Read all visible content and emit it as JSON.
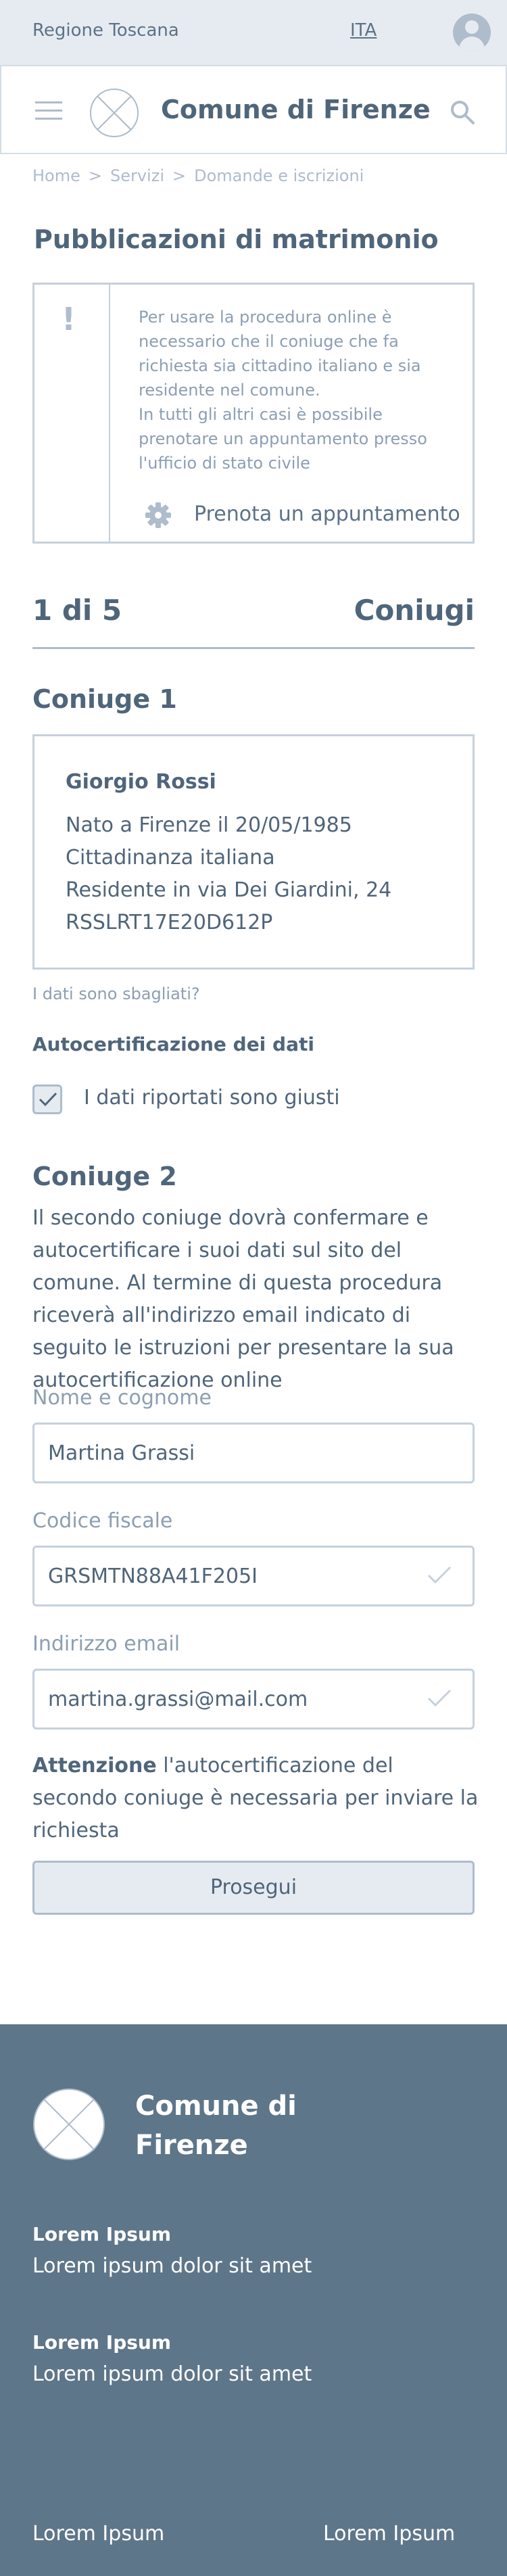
{
  "topbar": {
    "region": "Regione Toscana",
    "language": "ITA",
    "avatar_icon": "user-avatar-icon"
  },
  "header": {
    "title": "Comune di Firenze",
    "menu_icon": "hamburger-icon",
    "search_icon": "search-icon"
  },
  "breadcrumb": {
    "items": [
      "Home",
      "Servizi",
      "Domande e iscrizioni"
    ]
  },
  "page": {
    "title": "Pubblicazioni di matrimonio"
  },
  "alert": {
    "text": "Per usare la procedura online è\nnecessario che il coniuge che fa\nrichiesta sia cittadino italiano e sia\nresidente nel comune.\nIn tutti gli altri casi è possibile\nprenotare un appuntamento presso\nl'ufficio di stato civile",
    "link": "Prenota un appuntamento"
  },
  "steps": {
    "count": "1 di 5",
    "name": "Coniugi"
  },
  "spouse1": {
    "heading": "Coniuge 1",
    "name": "Giorgio Rossi",
    "lines": [
      "Nato a Firenze il 20/05/1985",
      "Cittadinanza italiana",
      "Residente in via Dei Giardini, 24",
      "RSSLRT17E20D612P"
    ],
    "wrong_link": "I dati sono sbagliati?",
    "self_cert_label": "Autocertificazione dei dati",
    "checkbox_label": "I dati riportati sono giusti",
    "checked": true
  },
  "spouse2": {
    "heading": "Coniuge 2",
    "description": "Il secondo coniuge dovrà confermare e autocertificare i suoi dati sul sito del comune. Al termine di questa procedura riceverà all'indirizzo email indicato di seguito le istruzioni per presentare la sua autocertificazione online",
    "fields": {
      "name_label": "Nome e cognome",
      "name_value": "Martina Grassi",
      "tax_label": "Codice fiscale",
      "tax_value": "GRSMTN88A41F205I",
      "email_label": "Indirizzo email",
      "email_value": "martina.grassi@mail.com"
    },
    "note_bold": "Attenzione",
    "note_text": " l'autocertificazione del secondo coniuge è necessaria per inviare la richiesta"
  },
  "actions": {
    "continue": "Prosegui"
  },
  "footer": {
    "title": "Comune di Firenze",
    "blocks": [
      {
        "heading": "Lorem Ipsum",
        "text": "Lorem ipsum dolor sit amet"
      },
      {
        "heading": "Lorem Ipsum",
        "text": "Lorem ipsum dolor sit amet"
      }
    ],
    "links": [
      "Lorem Ipsum",
      "Lorem Ipsum"
    ]
  },
  "colors": {
    "primary": "#4f657a",
    "muted": "#8c9fb2",
    "border": "#c5d1dc",
    "footer_bg": "#5e7689",
    "topbar_bg": "#e6ebf1"
  }
}
